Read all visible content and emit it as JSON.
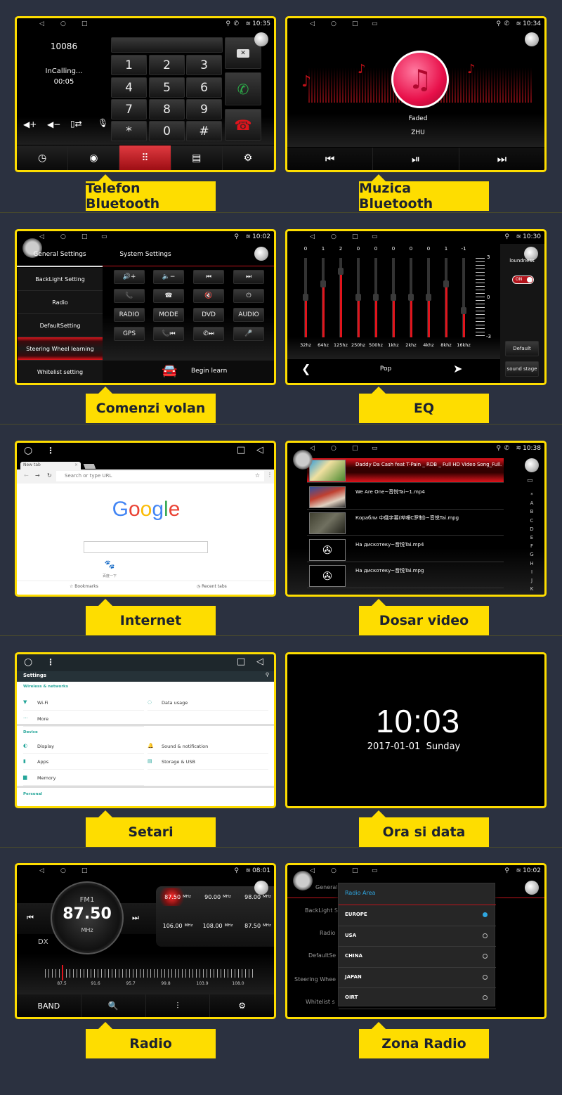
{
  "colors": {
    "background": "#2b3140",
    "accent_yellow": "#fedd00",
    "red": "#e0141c",
    "teal": "#26a69a",
    "dialog_blue": "#2fa6e0"
  },
  "captions": [
    "Telefon Bluetooth",
    "Muzica Bluetooth",
    "Comenzi volan",
    "EQ",
    "Internet",
    "Dosar video",
    "Setari",
    "Ora si data",
    "Radio",
    "Zona Radio"
  ],
  "phone": {
    "time": "10:35",
    "number": "10086",
    "status": "InCalling...",
    "duration": "00:05",
    "keys": [
      "1",
      "2",
      "3",
      "4",
      "5",
      "6",
      "7",
      "8",
      "9",
      "*",
      "0",
      "#"
    ],
    "tabs": [
      "clock-icon",
      "contacts-icon",
      "dialpad-icon",
      "call-log-icon",
      "gear-icon"
    ],
    "active_tab": 2
  },
  "music": {
    "time": "10:34",
    "title": "Faded",
    "artist": "ZHU"
  },
  "steering": {
    "time": "10:02",
    "tabs": [
      "General Settings",
      "System Settings"
    ],
    "menu": [
      "BackLight Setting",
      "Radio",
      "DefaultSetting",
      "Steering Wheel learning",
      "Whitelist setting"
    ],
    "active_menu": 3,
    "buttons": [
      "🔊+",
      "🔈−",
      "⏮",
      "⏭",
      "📞",
      "☎",
      "🔇",
      "⏻",
      "RADIO",
      "MODE",
      "DVD",
      "AUDIO",
      "GPS",
      "📞⏮",
      "✆⏭",
      "🎤"
    ],
    "begin_learn": "Begin learn"
  },
  "eq": {
    "time": "10:30",
    "bands": [
      "32hz",
      "64hz",
      "125hz",
      "250hz",
      "500hz",
      "1khz",
      "2khz",
      "4khz",
      "8khz",
      "16khz"
    ],
    "values": [
      0,
      1,
      2,
      0,
      0,
      0,
      0,
      0,
      1,
      -1
    ],
    "range": [
      -3,
      3
    ],
    "scale_labels": [
      "3",
      "0",
      "-3"
    ],
    "loudness_label": "loundness",
    "loudness_toggle": "ON",
    "loudness_on": true,
    "default_label": "Default",
    "sound_stage_label": "sound stage",
    "preset": "Pop"
  },
  "browser": {
    "tab_title": "New tab",
    "url_placeholder": "Search or type URL",
    "logo": "Google",
    "shortcut_label": "百度一下",
    "bookmarks": "Bookmarks",
    "recent_tabs": "Recent tabs"
  },
  "video": {
    "time": "10:38",
    "files": [
      "Daddy Da Cash feat T-Pain _ RDB _ Full HD Video Song_Full...",
      "We Are One~音悦Tai~1.mp4",
      "Корабли 中俄字幕(哔哩C罗制)~音悦Tai.mpg",
      "На дискотеку~音悦Tai.mp4",
      "На дискотеку~音悦Tai.mpg"
    ],
    "active": 0,
    "index": [
      "*",
      "A",
      "B",
      "C",
      "D",
      "E",
      "F",
      "G",
      "H",
      "I",
      "J",
      "K"
    ]
  },
  "settings": {
    "title": "Settings",
    "sections": [
      {
        "header": "Wireless & networks",
        "items": [
          {
            "label": "Wi-Fi",
            "icon": "wifi-icon"
          },
          {
            "label": "Data usage",
            "icon": "data-usage-icon"
          },
          {
            "label": "More",
            "icon": "more-icon"
          }
        ]
      },
      {
        "header": "Device",
        "items": [
          {
            "label": "Display",
            "icon": "display-icon"
          },
          {
            "label": "Sound & notification",
            "icon": "bell-icon"
          },
          {
            "label": "Apps",
            "icon": "apps-icon"
          },
          {
            "label": "Storage & USB",
            "icon": "storage-icon"
          },
          {
            "label": "Memory",
            "icon": "memory-icon"
          }
        ]
      },
      {
        "header": "Personal",
        "items": []
      }
    ]
  },
  "clock": {
    "time": "10:03",
    "date": "2017-01-01  Sunday"
  },
  "radio": {
    "time": "08:01",
    "band": "FM1",
    "frequency": "87.50",
    "unit": "MHz",
    "dx": "DX",
    "presets": [
      "87.50",
      "90.00",
      "98.00",
      "106.00",
      "108.00",
      "87.50"
    ],
    "active_preset": 0,
    "scale_labels": [
      "87.5",
      "91.6",
      "95.7",
      "99.8",
      "103.9",
      "108.0"
    ],
    "band_button": "BAND"
  },
  "radio_area": {
    "time": "10:02",
    "title": "Radio Area",
    "options": [
      "EUROPE",
      "USA",
      "CHINA",
      "JAPAN",
      "OIRT"
    ],
    "selected": 0,
    "bg_menu": [
      "General Se",
      "BackLight S",
      "Radio",
      "DefaultSe",
      "Steering Whee",
      "Whitelist s"
    ]
  }
}
